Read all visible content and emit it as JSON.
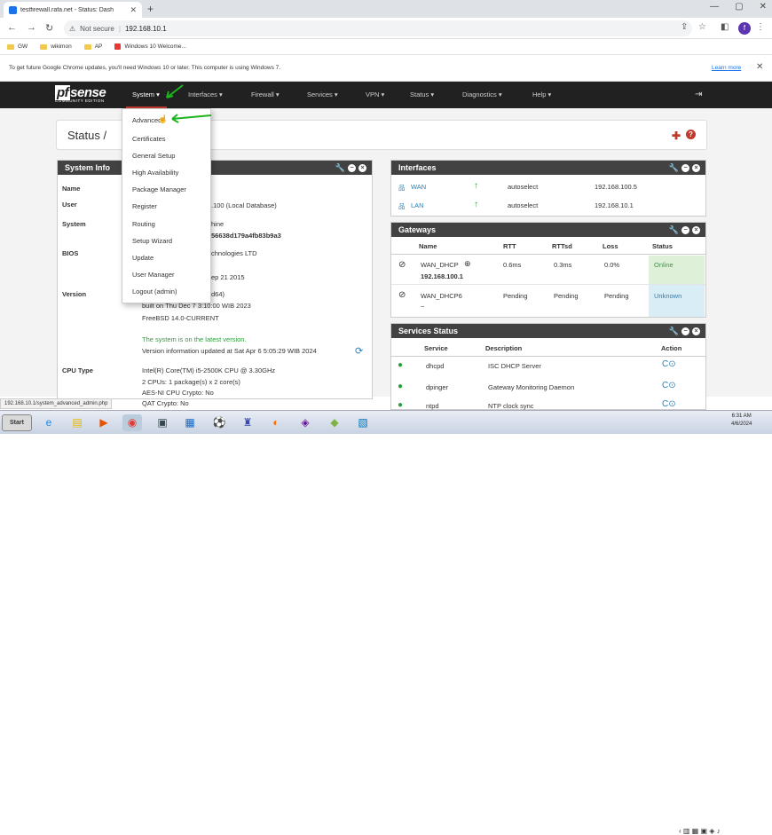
{
  "browser": {
    "tab_title": "testfirewall.rafa.net - Status: Dash",
    "not_secure": "Not secure",
    "url": "192.168.10.1",
    "bookmarks": [
      "GW",
      "wikimon",
      "AP",
      "Windows 10 Welcome..."
    ],
    "infobar_message": "To get future Google Chrome updates, you'll need Windows 10 or later. This computer is using Windows 7.",
    "learn_more": "Learn more",
    "profile_initial": "f",
    "status_url": "192.168.10.1/system_advanced_admin.php"
  },
  "pfsense": {
    "logo": "sense",
    "logo_sub": "COMMUNITY EDITION",
    "menu": [
      "System ▾",
      "Interfaces ▾",
      "Firewall ▾",
      "Services ▾",
      "VPN ▾",
      "Status ▾",
      "Diagnostics ▾",
      "Help ▾"
    ],
    "breadcrumb_1": "Status /",
    "breadcrumb_2": "D",
    "system_menu": [
      "Advanced",
      "Certificates",
      "General Setup",
      "High Availability",
      "Package Manager",
      "Register",
      "Routing",
      "Setup Wizard",
      "Update",
      "User Manager",
      "Logout (admin)"
    ]
  },
  "system_info": {
    "title": "System Info",
    "rows": [
      {
        "label": "Name",
        "value": ""
      },
      {
        "label": "User",
        "value": ".100 (Local Database)"
      },
      {
        "label": "System",
        "value": "hine",
        "value2": "56638d179a4fb83b9a3"
      },
      {
        "label": "BIOS",
        "value": "chnologies LTD",
        "value2": "ep 21 2015"
      },
      {
        "label": "Version",
        "value": "d64)",
        "value2": "built on Thu Dec 7 3:10:00 WIB 2023",
        "value3": "FreeBSD 14.0-CURRENT",
        "value4": "The system is on the latest version.",
        "value5": "Version information updated at Sat Apr 6 5:05:29 WIB 2024"
      },
      {
        "label": "CPU Type",
        "value": "Intel(R) Core(TM) i5-2500K CPU @ 3.30GHz",
        "value2": "2 CPUs: 1 package(s) x 2 core(s)",
        "value3": "AES-NI CPU Crypto: No",
        "value4": "QAT Crypto: No"
      }
    ]
  },
  "interfaces": {
    "title": "Interfaces",
    "rows": [
      {
        "name": "WAN",
        "media": "autoselect",
        "ip": "192.168.100.5"
      },
      {
        "name": "LAN",
        "media": "autoselect",
        "ip": "192.168.10.1"
      }
    ]
  },
  "gateways": {
    "title": "Gateways",
    "headers": [
      "Name",
      "RTT",
      "RTTsd",
      "Loss",
      "Status"
    ],
    "rows": [
      {
        "name": "WAN_DHCP",
        "ip": "192.168.100.1",
        "rtt": "0.6ms",
        "rttsd": "0.3ms",
        "loss": "0.0%",
        "status": "Online"
      },
      {
        "name": "WAN_DHCP6",
        "ip": "~",
        "rtt": "Pending",
        "rttsd": "Pending",
        "loss": "Pending",
        "status": "Unknown"
      }
    ]
  },
  "services": {
    "title": "Services Status",
    "headers": [
      "Service",
      "Description",
      "Action"
    ],
    "rows": [
      {
        "service": "dhcpd",
        "description": "ISC DHCP Server"
      },
      {
        "service": "dpinger",
        "description": "Gateway Monitoring Daemon"
      },
      {
        "service": "ntpd",
        "description": "NTP clock sync"
      }
    ]
  },
  "taskbar": {
    "start": "Start",
    "time": "6:31 AM",
    "date": "4/6/2024"
  },
  "colors": {
    "accent_red": "#c0392b",
    "online_bg": "#dff0d8",
    "unknown_bg": "#d9edf7",
    "panel_header": "#424242"
  }
}
